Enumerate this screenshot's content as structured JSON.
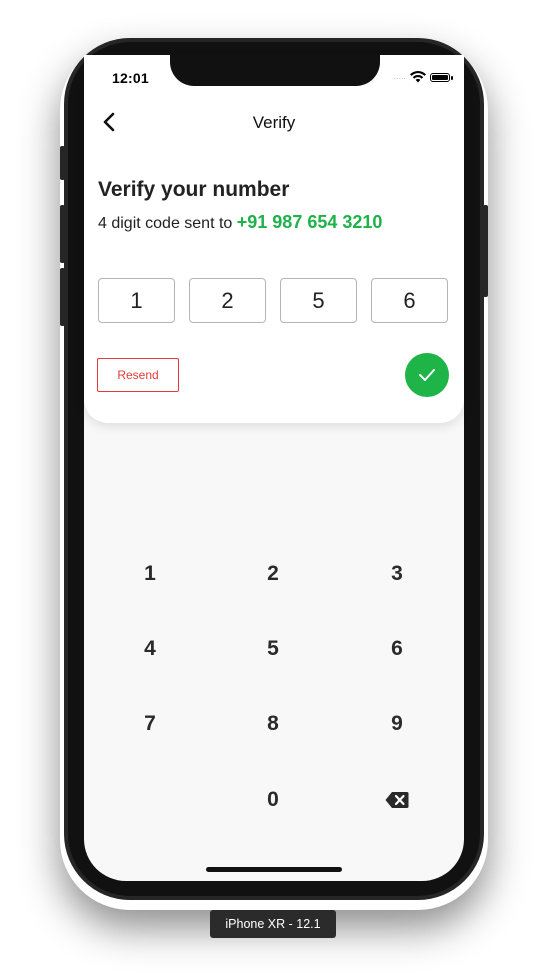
{
  "status_bar": {
    "time": "12:01",
    "signal": "....."
  },
  "nav": {
    "title": "Verify",
    "back_icon": "chevron-left-icon"
  },
  "content": {
    "heading": "Verify your number",
    "subtext": "4 digit code sent to",
    "phone_number": "+91 987 654 3210"
  },
  "code_digits": [
    "1",
    "2",
    "5",
    "6"
  ],
  "actions": {
    "resend_label": "Resend",
    "confirm_icon": "checkmark-icon"
  },
  "keypad": {
    "keys": [
      "1",
      "2",
      "3",
      "4",
      "5",
      "6",
      "7",
      "8",
      "9",
      "0"
    ],
    "backspace_icon": "backspace-icon"
  },
  "device_label": "iPhone XR - 12.1",
  "colors": {
    "accent_green": "#1fb24a",
    "resend_red": "#e53935"
  }
}
